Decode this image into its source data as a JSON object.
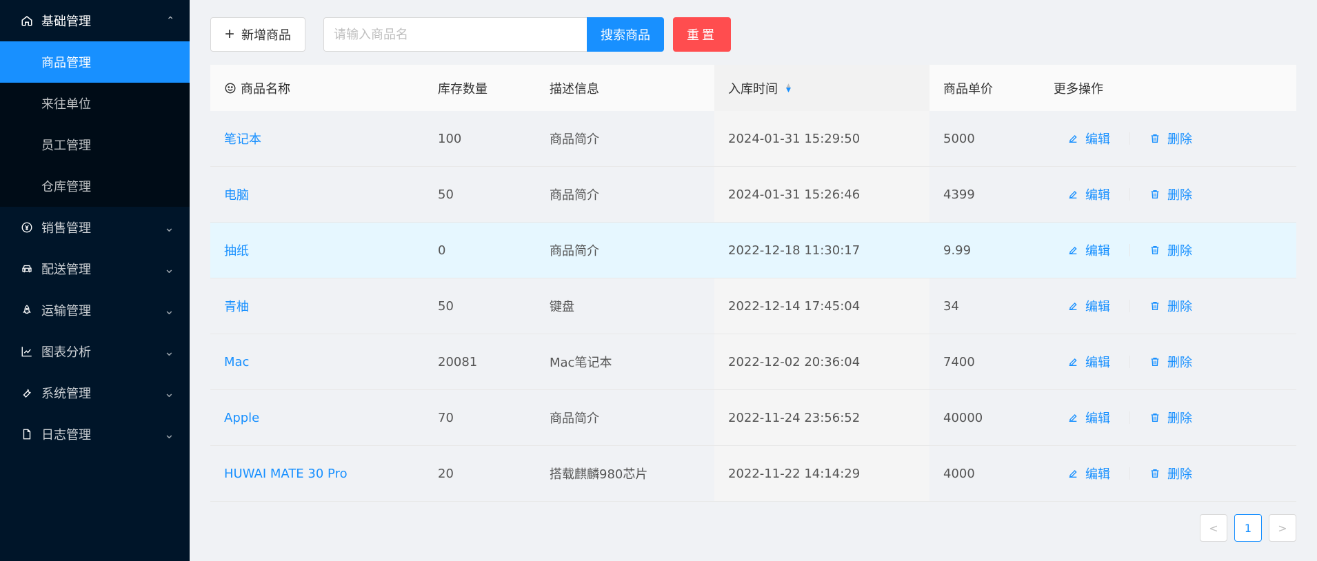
{
  "sidebar": {
    "group": {
      "label": "基础管理",
      "icon": "home-icon",
      "expanded": true
    },
    "submenu": [
      {
        "label": "商品管理",
        "active": true
      },
      {
        "label": "来往单位"
      },
      {
        "label": "员工管理"
      },
      {
        "label": "仓库管理"
      }
    ],
    "items": [
      {
        "label": "销售管理",
        "icon": "yen-icon"
      },
      {
        "label": "配送管理",
        "icon": "car-icon"
      },
      {
        "label": "运输管理",
        "icon": "rocket-icon"
      },
      {
        "label": "图表分析",
        "icon": "line-chart-icon"
      },
      {
        "label": "系统管理",
        "icon": "tool-icon"
      },
      {
        "label": "日志管理",
        "icon": "file-icon"
      }
    ]
  },
  "toolbar": {
    "add_label": "新增商品",
    "search_placeholder": "请输入商品名",
    "search_value": "",
    "search_label": "搜索商品",
    "reset_label": "重置"
  },
  "table": {
    "columns": [
      "商品名称",
      "库存数量",
      "描述信息",
      "入库时间",
      "商品单价",
      "更多操作"
    ],
    "sorted_column": "入库时间",
    "sort_order": "descending",
    "rows": [
      {
        "name": "笔记本",
        "stock": "100",
        "desc": "商品简介",
        "time": "2024-01-31 15:29:50",
        "price": "5000"
      },
      {
        "name": "电脑",
        "stock": "50",
        "desc": "商品简介",
        "time": "2024-01-31 15:26:46",
        "price": "4399"
      },
      {
        "name": "抽纸",
        "stock": "0",
        "desc": "商品简介",
        "time": "2022-12-18 11:30:17",
        "price": "9.99",
        "highlight": true
      },
      {
        "name": "青柚",
        "stock": "50",
        "desc": "键盘",
        "time": "2022-12-14 17:45:04",
        "price": "34"
      },
      {
        "name": "Mac",
        "stock": "20081",
        "desc": "Mac笔记本",
        "time": "2022-12-02 20:36:04",
        "price": "7400"
      },
      {
        "name": "Apple",
        "stock": "70",
        "desc": "商品简介",
        "time": "2022-11-24 23:56:52",
        "price": "40000"
      },
      {
        "name": "HUWAI MATE 30 Pro",
        "stock": "20",
        "desc": "搭载麒麟980芯片",
        "time": "2022-11-22 14:14:29",
        "price": "4000"
      }
    ],
    "ops": {
      "edit": "编辑",
      "delete": "删除"
    }
  },
  "pagination": {
    "prev": "<",
    "current": "1",
    "next": ">"
  },
  "colors": {
    "primary": "#1890ff",
    "danger": "#ff4d4f",
    "sidebar_bg": "#001529"
  }
}
